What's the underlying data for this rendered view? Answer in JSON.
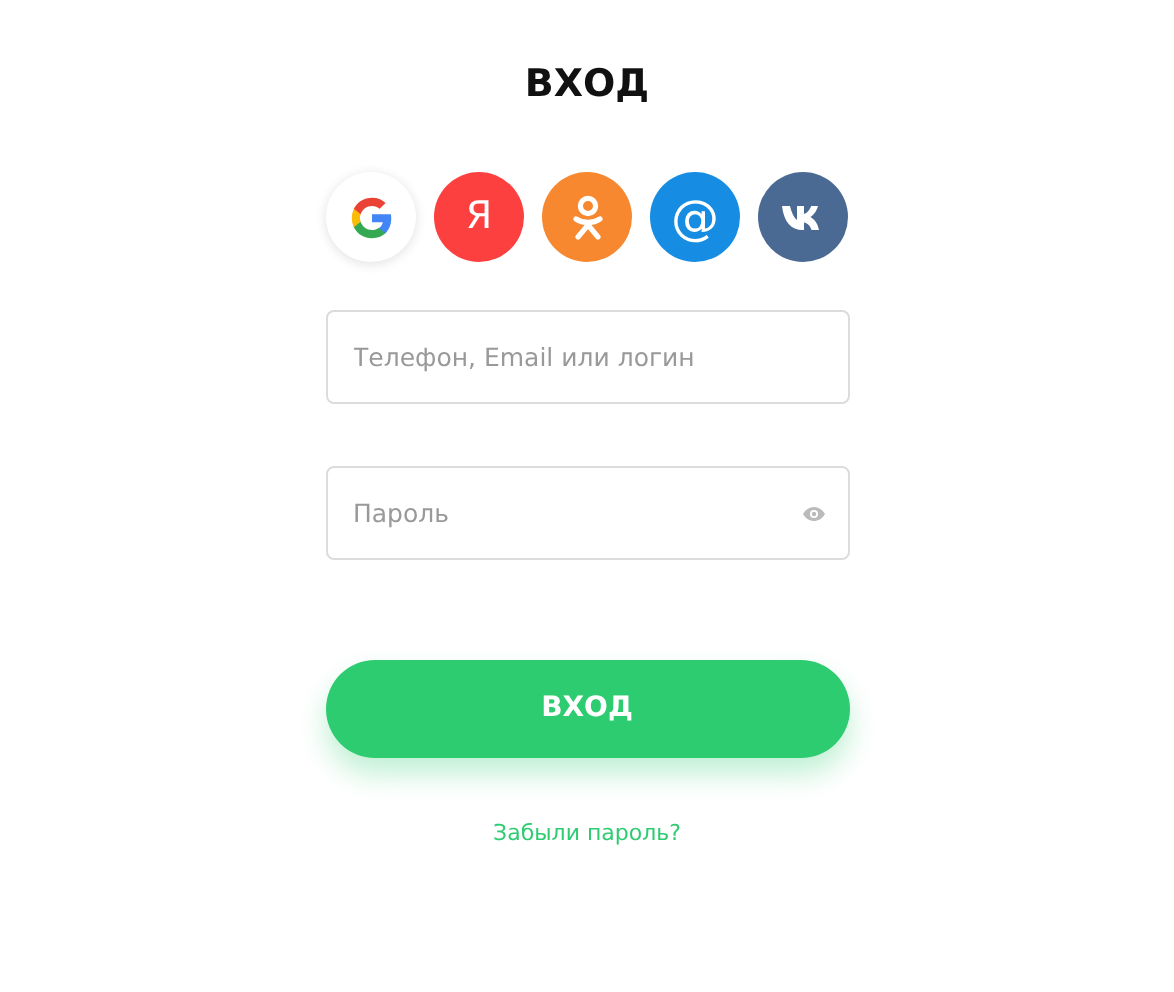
{
  "title": "ВХОД",
  "social": [
    {
      "kind": "google",
      "color": "#ffffff"
    },
    {
      "kind": "yandex",
      "color": "#fc3f3f",
      "label": "Я"
    },
    {
      "kind": "ok",
      "color": "#f7882f"
    },
    {
      "kind": "mail",
      "color": "#168de2",
      "label": "@"
    },
    {
      "kind": "vk",
      "color": "#4a6a94"
    }
  ],
  "fields": [
    {
      "kind": "text",
      "placeholder": "Телефон, Email или логин"
    },
    {
      "kind": "password",
      "placeholder": "Пароль"
    }
  ],
  "submit": "ВХОД",
  "forgot": "Забыли пароль?"
}
